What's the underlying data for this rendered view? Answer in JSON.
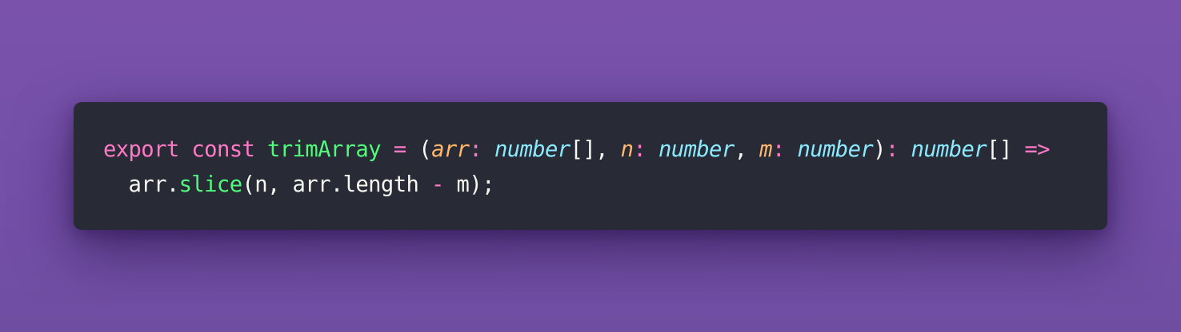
{
  "code": {
    "line1": [
      {
        "text": "export",
        "role": "keyword"
      },
      {
        "text": " ",
        "role": "space"
      },
      {
        "text": "const",
        "role": "keyword"
      },
      {
        "text": " ",
        "role": "space"
      },
      {
        "text": "trimArray",
        "role": "function"
      },
      {
        "text": " ",
        "role": "space"
      },
      {
        "text": "=",
        "role": "operator"
      },
      {
        "text": " (",
        "role": "plain"
      },
      {
        "text": "arr",
        "role": "param"
      },
      {
        "text": ":",
        "role": "operator"
      },
      {
        "text": " ",
        "role": "space"
      },
      {
        "text": "number",
        "role": "type"
      },
      {
        "text": "[], ",
        "role": "plain"
      },
      {
        "text": "n",
        "role": "param"
      },
      {
        "text": ":",
        "role": "operator"
      },
      {
        "text": " ",
        "role": "space"
      },
      {
        "text": "number",
        "role": "type"
      },
      {
        "text": ", ",
        "role": "plain"
      },
      {
        "text": "m",
        "role": "param"
      },
      {
        "text": ":",
        "role": "operator"
      },
      {
        "text": " ",
        "role": "space"
      },
      {
        "text": "number",
        "role": "type"
      },
      {
        "text": ")",
        "role": "plain"
      },
      {
        "text": ":",
        "role": "operator"
      },
      {
        "text": " ",
        "role": "space"
      },
      {
        "text": "number",
        "role": "type"
      },
      {
        "text": "[] ",
        "role": "plain"
      },
      {
        "text": "=>",
        "role": "operator"
      }
    ],
    "line2": [
      {
        "text": "  arr.",
        "role": "plain"
      },
      {
        "text": "slice",
        "role": "function"
      },
      {
        "text": "(n, arr.length ",
        "role": "plain"
      },
      {
        "text": "-",
        "role": "operator"
      },
      {
        "text": " m);",
        "role": "plain"
      }
    ]
  },
  "colors": {
    "background": "#7652aa",
    "card": "#282a36",
    "keyword": "#ff79c6",
    "function": "#50fa7b",
    "param": "#ffb86c",
    "type": "#8be9fd",
    "plain": "#f8f8f2"
  }
}
